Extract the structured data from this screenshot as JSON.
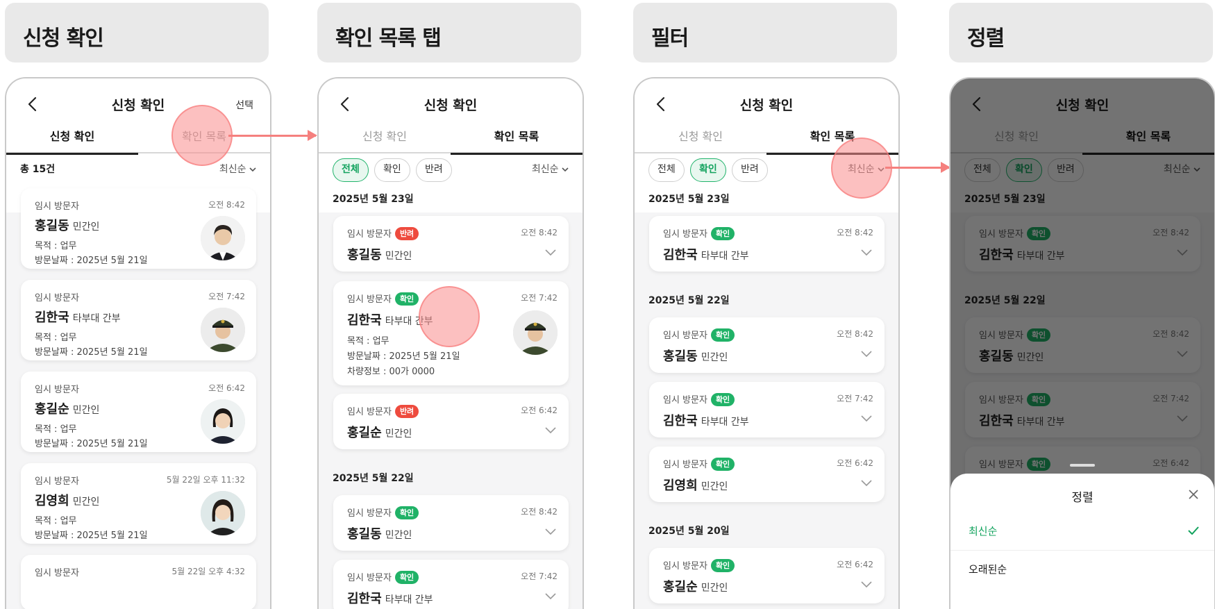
{
  "panels": [
    {
      "header": "신청 확인"
    },
    {
      "header": "확인 목록 탭"
    },
    {
      "header": "필터"
    },
    {
      "header": "정렬"
    }
  ],
  "app": {
    "title": "신청 확인",
    "select_label": "선택",
    "tabs": [
      "신청 확인",
      "확인 목록"
    ],
    "sort_label": "최신순",
    "total_label": "총 15건",
    "filters": [
      "전체",
      "확인",
      "반려"
    ]
  },
  "common": {
    "kind": "임시 방문자",
    "purpose": "목적 : 업무",
    "visit_date": "방문날짜 : 2025년 5월 21일",
    "vehicle": "차량정보 : 00가 0000"
  },
  "badges": {
    "ok": "확인",
    "no": "반려"
  },
  "panel1_cards": [
    {
      "time": "오전 8:42",
      "name": "홍길동",
      "org": "민간인"
    },
    {
      "time": "오전 7:42",
      "name": "김한국",
      "org": "타부대 간부"
    },
    {
      "time": "오전 6:42",
      "name": "홍길순",
      "org": "민간인"
    },
    {
      "time": "5월 22일 오후 11:32",
      "name": "김영희",
      "org": "민간인"
    },
    {
      "time": "5월 22일 오후 4:32"
    }
  ],
  "panel2": {
    "date1": "2025년 5월 23일",
    "date2": "2025년 5월 22일",
    "cards": [
      {
        "time": "오전 8:42",
        "name": "홍길동",
        "org": "민간인"
      },
      {
        "time": "오전 7:42",
        "name": "김한국",
        "org": "타부대 간부"
      },
      {
        "time": "오전 6:42",
        "name": "홍길순",
        "org": "민간인"
      },
      {
        "time": "오전 8:42",
        "name": "홍길동",
        "org": "민간인"
      },
      {
        "time": "오전 7:42",
        "name": "김한국",
        "org": "타부대 간부"
      }
    ]
  },
  "panel3": {
    "date1": "2025년 5월 23일",
    "date2": "2025년 5월 22일",
    "date3": "2025년 5월 20일",
    "cards": [
      {
        "time": "오전 8:42",
        "name": "김한국",
        "org": "타부대 간부"
      },
      {
        "time": "오전 8:42",
        "name": "홍길동",
        "org": "민간인"
      },
      {
        "time": "오전 7:42",
        "name": "김한국",
        "org": "타부대 간부"
      },
      {
        "time": "오전 6:42",
        "name": "김영희",
        "org": "민간인"
      },
      {
        "time": "오전 6:42",
        "name": "홍길순",
        "org": "민간인"
      }
    ]
  },
  "sheet": {
    "title": "정렬",
    "options": [
      "최신순",
      "오래된순"
    ]
  },
  "colors": {
    "accent": "#13a35e",
    "reject": "#ee4b3e",
    "tap": "#f5807e"
  }
}
